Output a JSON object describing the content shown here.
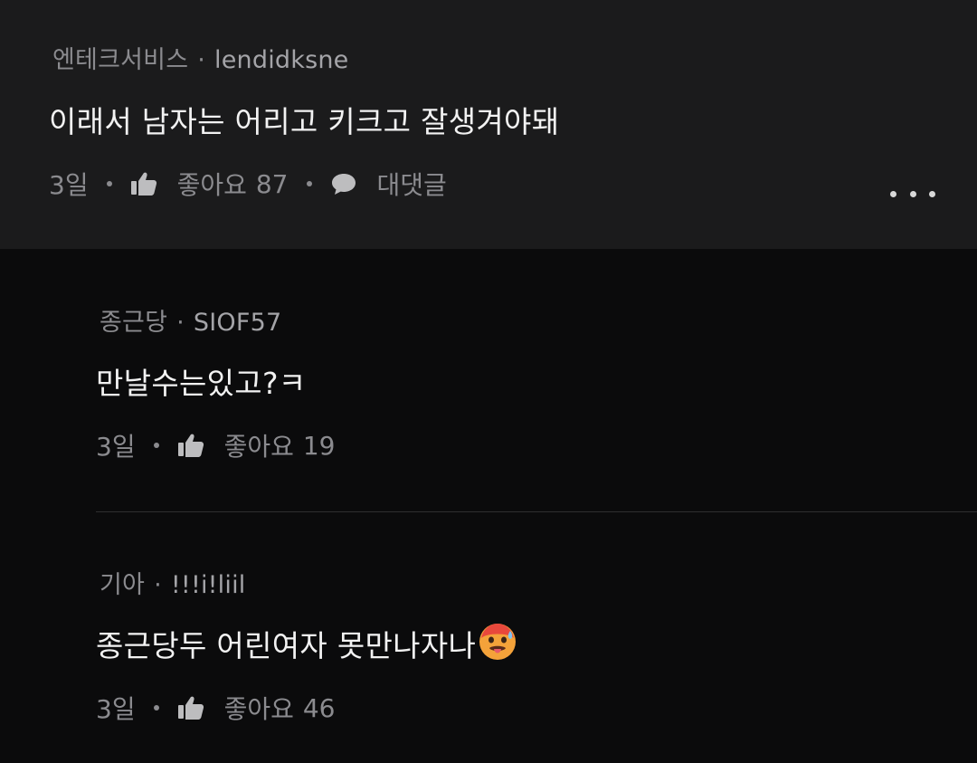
{
  "top_comment": {
    "nickname": "엔테크서비스",
    "user_id": "lendidksne",
    "text": "이래서 남자는 어리고 키크고 잘생겨야돼",
    "time": "3일",
    "like_label": "좋아요",
    "like_count": "87",
    "reply_label": "대댓글"
  },
  "replies": [
    {
      "nickname": "종근당",
      "user_id": "SIOF57",
      "text": "만날수는있고?ㅋ",
      "time": "3일",
      "like_label": "좋아요",
      "like_count": "19"
    },
    {
      "nickname": "기아",
      "user_id": "!!!i!liil",
      "text": "종근당두 어린여자 못만나자나",
      "emoji": "hot-face-emoji",
      "time": "3일",
      "like_label": "좋아요",
      "like_count": "46"
    }
  ],
  "icons": {
    "like": "thumbs-up-icon",
    "reply": "speech-bubble-icon",
    "more": "more-horizontal-icon"
  },
  "colors": {
    "top_background": "#1b1b1c",
    "page_background": "#0b0b0c",
    "meta_text": "#8b8b8f",
    "body_text": "#f2f2f2"
  }
}
